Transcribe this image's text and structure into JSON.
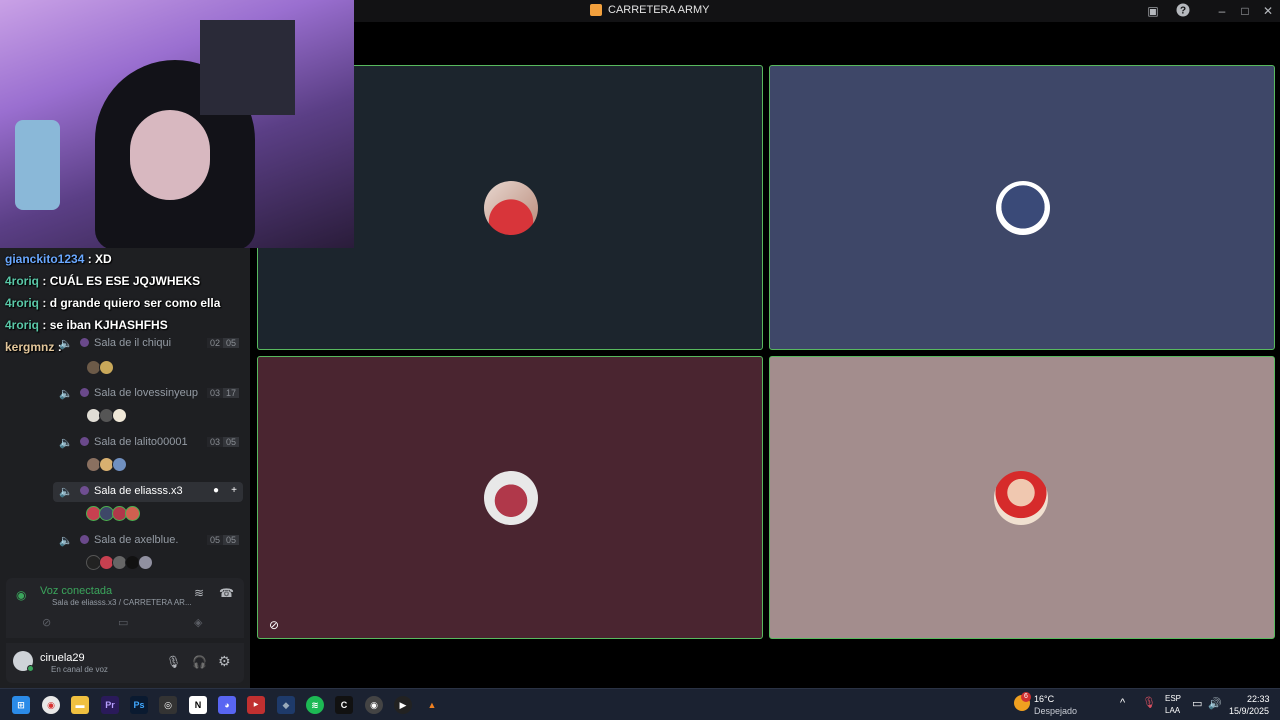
{
  "window": {
    "title": "CARRETERA ARMY"
  },
  "chat": [
    {
      "user": "gianckito1234",
      "message": ": XD",
      "color": "blue"
    },
    {
      "user": "4roriq",
      "message": ": CUÁL ES ESE JQJWHEKS",
      "color": "green"
    },
    {
      "user": "4roriq",
      "message": ": d grande quiero ser como ella",
      "color": "green"
    },
    {
      "user": "4roriq",
      "message": ": se iban KJHASHFHS",
      "color": "green"
    },
    {
      "user": "kergmnz",
      "message": ":",
      "color": "tan"
    }
  ],
  "rooms": [
    {
      "name": "Sala de il chiqui",
      "count_a": "02",
      "count_b": "05"
    },
    {
      "name": "Sala de lovessinyeup",
      "count_a": "03",
      "count_b": "17"
    },
    {
      "name": "Sala de lalito00001",
      "count_a": "03",
      "count_b": "05"
    },
    {
      "name": "Sala de eliasss.x3",
      "count_a": "",
      "count_b": ""
    },
    {
      "name": "Sala de axelblue.",
      "count_a": "05",
      "count_b": "05"
    }
  ],
  "voice": {
    "status": "Voz conectada",
    "channel": "Sala de eliasss.x3 / CARRETERA AR..."
  },
  "user": {
    "name": "ciruela29",
    "status": "En canal de voz"
  },
  "tiles": [
    {
      "bg": "#1c252d"
    },
    {
      "bg": "#3e4768"
    },
    {
      "bg": "#4a2530"
    },
    {
      "bg": "#a38d8d"
    }
  ],
  "taskbar": {
    "weather_temp": "16°C",
    "weather_desc": "Despejado",
    "lang_top": "ESP",
    "lang_bottom": "LAA",
    "time": "22:33",
    "date": "15/9/2025",
    "notification_count": "6"
  },
  "colors": {
    "accent_green": "#58b95e",
    "discord_bg": "#1e1f22"
  }
}
